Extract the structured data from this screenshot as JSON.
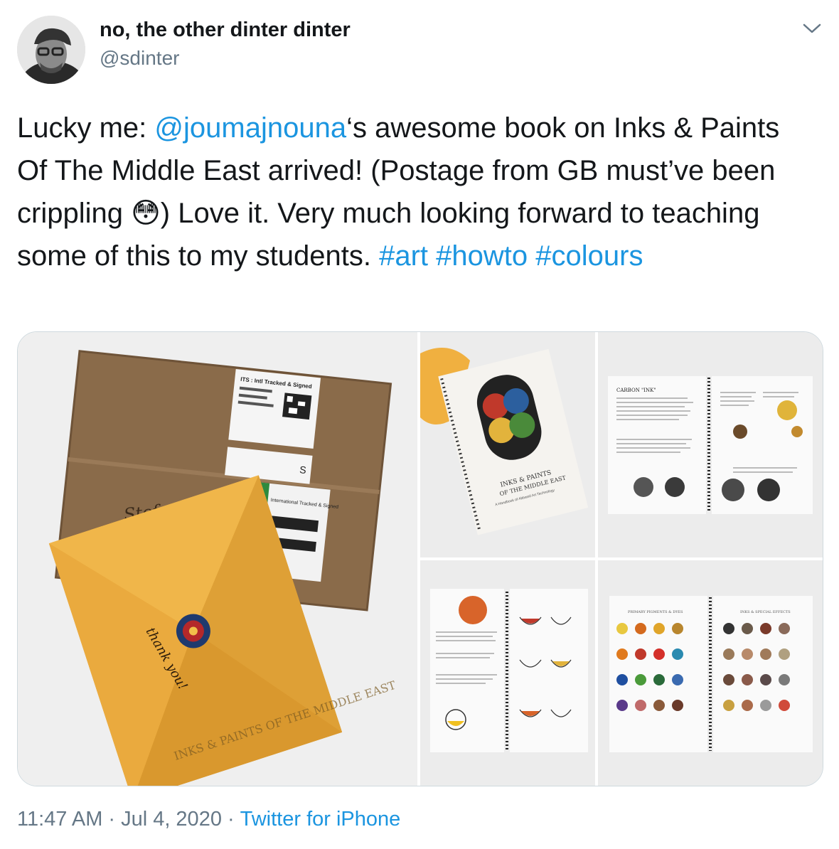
{
  "author": {
    "display_name": "no, the other dinter dinter",
    "handle": "@sdinter"
  },
  "tweet": {
    "prefix": "Lucky me: ",
    "mention": "@joumajnouna",
    "body": "‘s awesome book on Inks & Paints Of The Middle East arrived! (Postage from GB must’ve been crippling ",
    "emoji": "😳",
    "body2": ") Love it. Very much looking forward to teaching some of this to my students. ",
    "hashtags": [
      "#art",
      "#howto",
      "#colours"
    ]
  },
  "photos": {
    "package": {
      "label_line1": "ITS : Intl Tracked & Signed",
      "sender_name": "Stefan Dinter",
      "parcel_letter": "S",
      "parcel_label_text": "International Tracked & Signed",
      "note": "thank you!",
      "book_title_through_paper": "INKS & PAINTS OF THE MIDDLE EAST"
    },
    "book_cover": {
      "title_line1": "INKS & PAINTS",
      "title_line2": "OF THE MIDDLE EAST",
      "subtitle": "A Handbook of Abbasid Art Technology"
    },
    "spread_carbon": {
      "heading": "CARBON \"INK\""
    },
    "spread_pigments": {
      "left_heading": "PRIMARY PIGMENTS & DYES",
      "right_heading": "INKS & SPECIAL EFFECTS"
    }
  },
  "meta": {
    "time": "11:47 AM",
    "date": "Jul 4, 2020",
    "source": "Twitter for iPhone",
    "separator": "·"
  }
}
